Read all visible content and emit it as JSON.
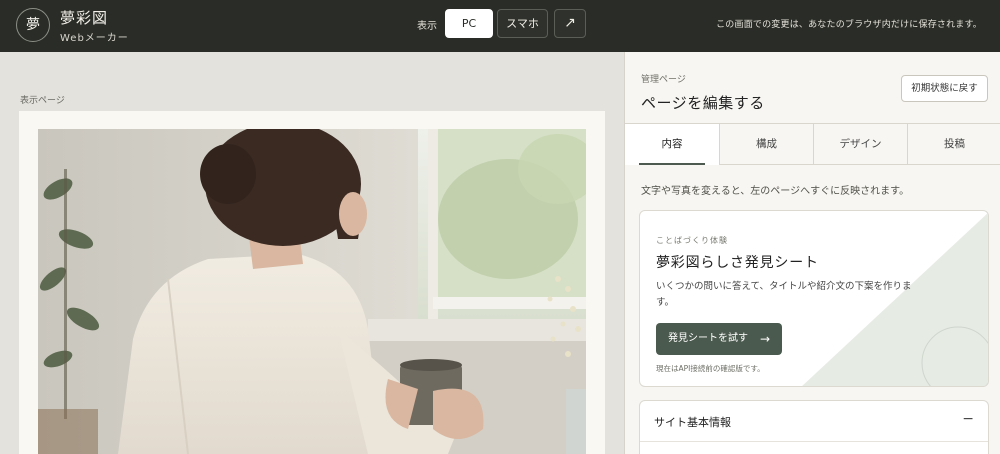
{
  "header": {
    "logo_char": "夢",
    "brand_title": "夢彩図",
    "brand_subtitle": "Webメーカー",
    "view_label": "表示",
    "view_options": [
      "PC",
      "スマホ"
    ],
    "active_view": "PC",
    "open_icon": "external-link-arrow-icon",
    "open_glyph": "↗",
    "save_note": "この画面での変更は、あなたのブラウザ内だけに保存されます。"
  },
  "preview": {
    "label": "表示ページ"
  },
  "panel": {
    "kicker": "管理ページ",
    "title": "ページを編集する",
    "reset_label": "初期状態に戻す",
    "tabs": [
      {
        "label": "内容",
        "active": true
      },
      {
        "label": "構成",
        "active": false
      },
      {
        "label": "デザイン",
        "active": false
      },
      {
        "label": "投稿",
        "active": false
      }
    ],
    "intro": "文字や写真を変えると、左のページへすぐに反映されます。",
    "card": {
      "kicker": "ことばづくり体験",
      "title": "夢彩図らしさ発見シート",
      "description": "いくつかの問いに答えて、タイトルや紹介文の下案を作ります。",
      "button_label": "発見シートを試す",
      "button_arrow": "→",
      "note": "現在はAPI接続前の確認版です。"
    },
    "section": {
      "title": "サイト基本情報",
      "toggle": "−"
    }
  },
  "colors": {
    "header_bg": "#2a2d27",
    "accent": "#4b5a4e",
    "page_bg": "#e4e2dc"
  }
}
